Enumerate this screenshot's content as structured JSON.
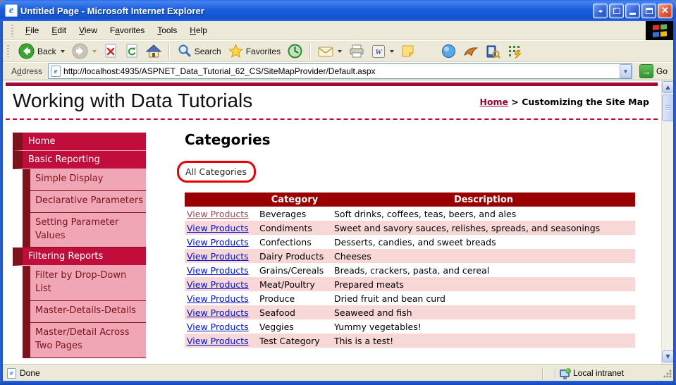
{
  "window": {
    "title": "Untitled Page - Microsoft Internet Explorer",
    "close_glyph": "✕"
  },
  "menu_bar": {
    "items": [
      {
        "label": "File",
        "accel": 0
      },
      {
        "label": "Edit",
        "accel": 0
      },
      {
        "label": "View",
        "accel": 0
      },
      {
        "label": "Favorites",
        "accel": 1
      },
      {
        "label": "Tools",
        "accel": 0
      },
      {
        "label": "Help",
        "accel": 0
      }
    ]
  },
  "toolbar": {
    "back_label": "Back",
    "search_label": "Search",
    "favorites_label": "Favorites",
    "word_glyph": "W"
  },
  "address_bar": {
    "label": "Address",
    "label_accel": 1,
    "url": "http://localhost:4935/ASPNET_Data_Tutorial_62_CS/SiteMapProvider/Default.aspx",
    "go_label": "Go",
    "go_arrow": "→"
  },
  "page": {
    "header": {
      "title": "Working with Data Tutorials",
      "breadcrumb": {
        "home": "Home",
        "separator": " > ",
        "current": "Customizing the Site Map"
      }
    },
    "sidebar": {
      "items": [
        {
          "label": "Home",
          "level": 0
        },
        {
          "label": "Basic Reporting",
          "level": 0
        },
        {
          "label": "Simple Display",
          "level": 1
        },
        {
          "label": "Declarative Parameters",
          "level": 1
        },
        {
          "label": "Setting Parameter Values",
          "level": 1
        },
        {
          "label": "Filtering Reports",
          "level": 0
        },
        {
          "label": "Filter by Drop-Down List",
          "level": 1
        },
        {
          "label": "Master-Details-Details",
          "level": 1
        },
        {
          "label": "Master/Detail Across Two Pages",
          "level": 1
        }
      ]
    },
    "main": {
      "heading": "Categories",
      "menu_label": "All Categories",
      "table": {
        "headers": [
          "",
          "Category",
          "Description"
        ],
        "link_label": "View Products",
        "rows": [
          {
            "category": "Beverages",
            "description": "Soft drinks, coffees, teas, beers, and ales",
            "visited": true
          },
          {
            "category": "Condiments",
            "description": "Sweet and savory sauces, relishes, spreads, and seasonings",
            "visited": false
          },
          {
            "category": "Confections",
            "description": "Desserts, candies, and sweet breads",
            "visited": false
          },
          {
            "category": "Dairy Products",
            "description": "Cheeses",
            "visited": false
          },
          {
            "category": "Grains/Cereals",
            "description": "Breads, crackers, pasta, and cereal",
            "visited": false
          },
          {
            "category": "Meat/Poultry",
            "description": "Prepared meats",
            "visited": false
          },
          {
            "category": "Produce",
            "description": "Dried fruit and bean curd",
            "visited": false
          },
          {
            "category": "Seafood",
            "description": "Seaweed and fish",
            "visited": false
          },
          {
            "category": "Veggies",
            "description": "Yummy vegetables!",
            "visited": false
          },
          {
            "category": "Test Category",
            "description": "This is a test!",
            "visited": false
          }
        ]
      }
    }
  },
  "status_bar": {
    "status": "Done",
    "zone": "Local intranet"
  },
  "colors": {
    "menu_crimson": "#c00d3c",
    "menu_maroon": "#7b141c",
    "menu_pink": "#f0a6b4",
    "table_header": "#990000",
    "row_alt_pink": "#f8d7d7",
    "link_blue": "#0014cc",
    "link_visited": "#9a4a5a",
    "annotation_red": "#e80000",
    "top_bar_red": "#a40c2f"
  }
}
